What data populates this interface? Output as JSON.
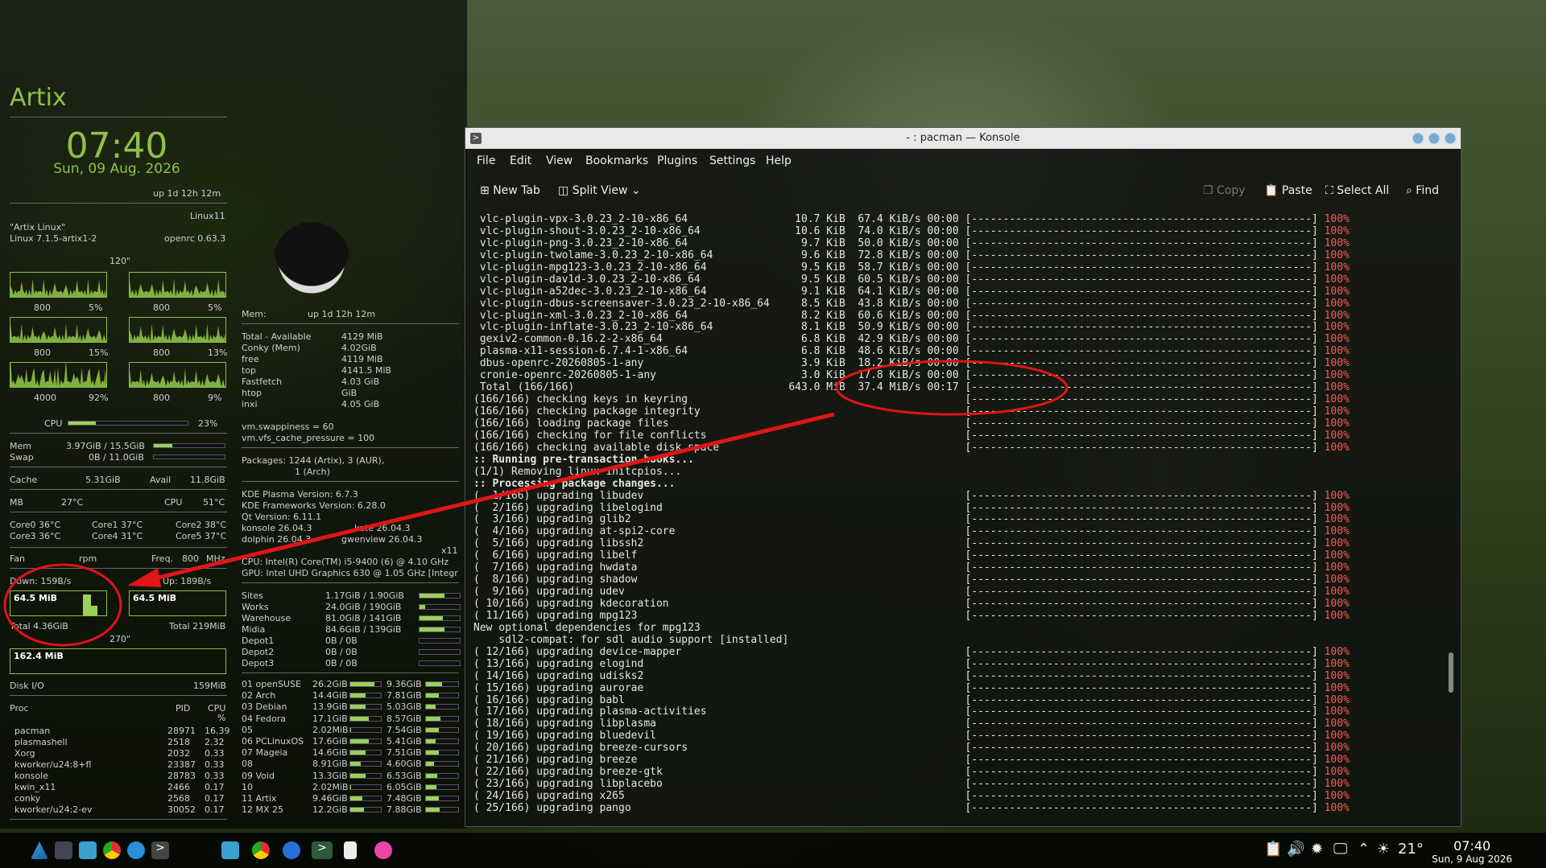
{
  "conky": {
    "distro": "Artix",
    "time": "07:40",
    "date": "Sun, 09 Aug. 2026",
    "uptime": "up 1d 12h 12m",
    "host": "Linux11",
    "os_name": "\"Artix Linux\"",
    "kernel": "Linux 7.1.5-artix1-2",
    "init": "openrc 0.63.3",
    "refresh": "120\"",
    "graphs": [
      {
        "freq": "800",
        "pct": "5%"
      },
      {
        "freq": "800",
        "pct": "5%"
      },
      {
        "freq": "800",
        "pct": "15%"
      },
      {
        "freq": "800",
        "pct": "13%"
      },
      {
        "freq": "4000",
        "pct": "92%"
      },
      {
        "freq": "800",
        "pct": "9%"
      }
    ],
    "cpu": {
      "label": "CPU",
      "pct": "23%",
      "fill": 0.23
    },
    "mem": {
      "label": "Mem",
      "value": "3.97GiB / 15.5GiB",
      "fill": 0.26
    },
    "swap": {
      "label": "Swap",
      "value": "0B / 11.0GiB",
      "fill": 0
    },
    "cache": {
      "label": "Cache",
      "value": "5.31GiB",
      "avail_label": "Avail",
      "avail": "11.8GiB"
    },
    "mb": {
      "label": "MB",
      "value": "27°C",
      "cpu_label": "CPU",
      "cpu_temp": "51°C"
    },
    "cores": [
      "Core0 36°C",
      "Core1 37°C",
      "Core2 38°C",
      "Core3 36°C",
      "Core4 31°C",
      "Core5 37°C"
    ],
    "fan": {
      "label": "Fan",
      "unit": "rpm",
      "freq_label": "Freq.",
      "freq": "800",
      "freq_unit": "MHz"
    },
    "net": {
      "down": "Down: 159B/s",
      "up": "Up: 189B/s",
      "down_box": "64.5 MiB",
      "up_box": "64.5 MiB",
      "total_down": "Total 4.36GiB",
      "total_up": "Total 219MiB",
      "interval": "270\""
    },
    "disk": {
      "box": "162.4 MiB",
      "label": "Disk I/O",
      "value": "159MiB"
    },
    "proc": {
      "label": "Proc",
      "pid_label": "PID",
      "cpu_label": "CPU",
      "pct_label": "%",
      "rows": [
        {
          "name": "pacman",
          "pid": "28971",
          "cpu": "16.39"
        },
        {
          "name": "plasmashell",
          "pid": "2518",
          "cpu": "2.32"
        },
        {
          "name": "Xorg",
          "pid": "2032",
          "cpu": "0.33"
        },
        {
          "name": "kworker/u24:8+fl",
          "pid": "23387",
          "cpu": "0.33"
        },
        {
          "name": "konsole",
          "pid": "28783",
          "cpu": "0.33"
        },
        {
          "name": "kwin_x11",
          "pid": "2466",
          "cpu": "0.17"
        },
        {
          "name": "conky",
          "pid": "2568",
          "cpu": "0.17"
        },
        {
          "name": "kworker/u24:2-ev",
          "pid": "30052",
          "cpu": "0.17"
        }
      ]
    },
    "memcol": {
      "mem_label": "Mem:",
      "uptime": "up 1d 12h 12m",
      "rows": [
        {
          "k": "Total - Available",
          "v": "4129 MiB"
        },
        {
          "k": "Conky (Mem)",
          "v": "4.02GiB"
        },
        {
          "k": "free",
          "v": "4119   MiB"
        },
        {
          "k": "top",
          "v": "4141.5  MiB"
        },
        {
          "k": "Fastfetch",
          "v": "4.03 GiB"
        },
        {
          "k": "htop",
          "v": "GiB"
        },
        {
          "k": "inxi",
          "v": "4.05 GiB"
        }
      ],
      "swappiness": "vm.swappiness = 60",
      "cache_pressure": "vm.vfs_cache_pressure = 100",
      "packages": "Packages: 1244 (Artix), 3 (AUR),",
      "packages2": "1 (Arch)",
      "plasma": "KDE Plasma Version: 6.7.3",
      "frameworks": "KDE Frameworks Version: 6.28.0",
      "qt": "Qt Version: 6.11.1",
      "konsole": "konsole 26.04.3",
      "kate": "kate 26.04.3",
      "dolphin": "dolphin 26.04.3",
      "gwenview": "gwenview 26.04.3",
      "x11": "x11",
      "cpuinfo": "CPU: Intel(R) Core(TM) i5-9400 (6) @ 4.10 GHz",
      "gpu": "GPU: Intel UHD Graphics 630 @ 1.05 GHz [Integr"
    },
    "mounts": [
      {
        "n": "Sites",
        "v": "1.17GiB  /  1.90GiB",
        "f": 0.62
      },
      {
        "n": "Works",
        "v": "24.0GiB  /  190GiB",
        "f": 0.13
      },
      {
        "n": "Warehouse",
        "v": "81.0GiB  /  141GiB",
        "f": 0.57
      },
      {
        "n": "Midia",
        "v": "84.6GiB  /  139GiB",
        "f": 0.61
      },
      {
        "n": "Depot1",
        "v": "0B  /  0B",
        "f": 0
      },
      {
        "n": "Depot2",
        "v": "0B  /  0B",
        "f": 0
      },
      {
        "n": "Depot3",
        "v": "0B  /  0B",
        "f": 0
      }
    ],
    "distros": [
      {
        "n": "01 openSUSE",
        "a": "26.2GiB",
        "b": "9.36GiB",
        "fa": 0.8,
        "fb": 0.5
      },
      {
        "n": "02 Arch",
        "a": "14.4GiB",
        "b": "7.81GiB",
        "fa": 0.5,
        "fb": 0.4
      },
      {
        "n": "03 Debian",
        "a": "13.9GiB",
        "b": "5.03GiB",
        "fa": 0.5,
        "fb": 0.3
      },
      {
        "n": "04 Fedora",
        "a": "17.1GiB",
        "b": "8.57GiB",
        "fa": 0.6,
        "fb": 0.45
      },
      {
        "n": "05",
        "a": "2.02MiB",
        "b": "7.54GiB",
        "fa": 0.02,
        "fb": 0.4
      },
      {
        "n": "06 PCLinuxOS",
        "a": "17.6GiB",
        "b": "5.41GiB",
        "fa": 0.6,
        "fb": 0.3
      },
      {
        "n": "07 Mageia",
        "a": "14.6GiB",
        "b": "7.51GiB",
        "fa": 0.5,
        "fb": 0.4
      },
      {
        "n": "08",
        "a": "8.91GiB",
        "b": "4.60GiB",
        "fa": 0.35,
        "fb": 0.25
      },
      {
        "n": "09 Void",
        "a": "13.3GiB",
        "b": "6.53GiB",
        "fa": 0.5,
        "fb": 0.35
      },
      {
        "n": "10",
        "a": "2.02MiB",
        "b": "6.05GiB",
        "fa": 0.02,
        "fb": 0.33
      },
      {
        "n": "11 Artix",
        "a": "9.46GiB",
        "b": "7.48GiB",
        "fa": 0.4,
        "fb": 0.4
      },
      {
        "n": "12 MX 25",
        "a": "12.2GiB",
        "b": "7.88GiB",
        "fa": 0.45,
        "fb": 0.42
      }
    ]
  },
  "konsole": {
    "title": "- : pacman — Konsole",
    "menu": [
      "File",
      "Edit",
      "View",
      "Bookmarks",
      "Plugins",
      "Settings",
      "Help"
    ],
    "toolbar": {
      "new_tab": "New Tab",
      "split_view": "Split View",
      "copy": "Copy",
      "paste": "Paste",
      "select_all": "Select All",
      "find": "Find"
    },
    "bar": "[------------------------------------------------------]",
    "lines": [
      {
        "t": " vlc-plugin-vpx-3.0.23_2-10-x86_64                 10.7 KiB  67.4 KiB/s 00:00 ",
        "b": 1,
        "p": "100%"
      },
      {
        "t": " vlc-plugin-shout-3.0.23_2-10-x86_64               10.6 KiB  74.0 KiB/s 00:00 ",
        "b": 1,
        "p": "100%"
      },
      {
        "t": " vlc-plugin-png-3.0.23_2-10-x86_64                  9.7 KiB  50.0 KiB/s 00:00 ",
        "b": 1,
        "p": "100%"
      },
      {
        "t": " vlc-plugin-twolame-3.0.23_2-10-x86_64              9.6 KiB  72.8 KiB/s 00:00 ",
        "b": 1,
        "p": "100%"
      },
      {
        "t": " vlc-plugin-mpg123-3.0.23_2-10-x86_64               9.5 KiB  58.7 KiB/s 00:00 ",
        "b": 1,
        "p": "100%"
      },
      {
        "t": " vlc-plugin-dav1d-3.0.23_2-10-x86_64                9.5 KiB  60.5 KiB/s 00:00 ",
        "b": 1,
        "p": "100%"
      },
      {
        "t": " vlc-plugin-a52dec-3.0.23_2-10-x86_64               9.1 KiB  64.1 KiB/s 00:00 ",
        "b": 1,
        "p": "100%"
      },
      {
        "t": " vlc-plugin-dbus-screensaver-3.0.23_2-10-x86_64     8.5 KiB  43.8 KiB/s 00:00 ",
        "b": 1,
        "p": "100%"
      },
      {
        "t": " vlc-plugin-xml-3.0.23_2-10-x86_64                  8.2 KiB  60.6 KiB/s 00:00 ",
        "b": 1,
        "p": "100%"
      },
      {
        "t": " vlc-plugin-inflate-3.0.23_2-10-x86_64              8.1 KiB  50.9 KiB/s 00:00 ",
        "b": 1,
        "p": "100%"
      },
      {
        "t": " gexiv2-common-0.16.2-2-x86_64                      6.8 KiB  42.9 KiB/s 00:00 ",
        "b": 1,
        "p": "100%"
      },
      {
        "t": " plasma-x11-session-6.7.4-1-x86_64                  6.8 KiB  48.6 KiB/s 00:00 ",
        "b": 1,
        "p": "100%"
      },
      {
        "t": " dbus-openrc-20260805-1-any                         3.9 KiB  18.2 KiB/s 00:00 ",
        "b": 1,
        "p": "100%"
      },
      {
        "t": " cronie-openrc-20260805-1-any                       3.0 KiB  17.8 KiB/s 00:00 ",
        "b": 1,
        "p": "100%"
      },
      {
        "t": " Total (166/166)                                  643.0 MiB  37.4 MiB/s 00:17 ",
        "b": 1,
        "p": "100%"
      },
      {
        "t": "(166/166) checking keys in keyring                                            ",
        "b": 1,
        "p": "100%"
      },
      {
        "t": "(166/166) checking package integrity                                          ",
        "b": 1,
        "p": "100%"
      },
      {
        "t": "(166/166) loading package files                                               ",
        "b": 1,
        "p": "100%"
      },
      {
        "t": "(166/166) checking for file conflicts                                         ",
        "b": 1,
        "p": "100%"
      },
      {
        "t": "(166/166) checking available disk space                                       ",
        "b": 1,
        "p": "100%"
      },
      {
        "t": ":: Running pre-transaction hooks...",
        "b": 0,
        "p": "",
        "bold": 1
      },
      {
        "t": "(1/1) Removing linux initcpios...",
        "b": 0,
        "p": ""
      },
      {
        "t": ":: Processing package changes...",
        "b": 0,
        "p": "",
        "bold": 1
      },
      {
        "t": "(  1/166) upgrading libudev                                                   ",
        "b": 1,
        "p": "100%"
      },
      {
        "t": "(  2/166) upgrading libelogind                                                ",
        "b": 1,
        "p": "100%"
      },
      {
        "t": "(  3/166) upgrading glib2                                                     ",
        "b": 1,
        "p": "100%"
      },
      {
        "t": "(  4/166) upgrading at-spi2-core                                              ",
        "b": 1,
        "p": "100%"
      },
      {
        "t": "(  5/166) upgrading libssh2                                                   ",
        "b": 1,
        "p": "100%"
      },
      {
        "t": "(  6/166) upgrading libelf                                                    ",
        "b": 1,
        "p": "100%"
      },
      {
        "t": "(  7/166) upgrading hwdata                                                    ",
        "b": 1,
        "p": "100%"
      },
      {
        "t": "(  8/166) upgrading shadow                                                    ",
        "b": 1,
        "p": "100%"
      },
      {
        "t": "(  9/166) upgrading udev                                                      ",
        "b": 1,
        "p": "100%"
      },
      {
        "t": "( 10/166) upgrading kdecoration                                               ",
        "b": 1,
        "p": "100%"
      },
      {
        "t": "( 11/166) upgrading mpg123                                                    ",
        "b": 1,
        "p": "100%"
      },
      {
        "t": "New optional dependencies for mpg123",
        "b": 0,
        "p": ""
      },
      {
        "t": "    sdl2-compat: for sdl audio support [installed]",
        "b": 0,
        "p": ""
      },
      {
        "t": "( 12/166) upgrading device-mapper                                             ",
        "b": 1,
        "p": "100%"
      },
      {
        "t": "( 13/166) upgrading elogind                                                   ",
        "b": 1,
        "p": "100%"
      },
      {
        "t": "( 14/166) upgrading udisks2                                                   ",
        "b": 1,
        "p": "100%"
      },
      {
        "t": "( 15/166) upgrading aurorae                                                   ",
        "b": 1,
        "p": "100%"
      },
      {
        "t": "( 16/166) upgrading babl                                                      ",
        "b": 1,
        "p": "100%"
      },
      {
        "t": "( 17/166) upgrading plasma-activities                                         ",
        "b": 1,
        "p": "100%"
      },
      {
        "t": "( 18/166) upgrading libplasma                                                 ",
        "b": 1,
        "p": "100%"
      },
      {
        "t": "( 19/166) upgrading bluedevil                                                 ",
        "b": 1,
        "p": "100%"
      },
      {
        "t": "( 20/166) upgrading breeze-cursors                                            ",
        "b": 1,
        "p": "100%"
      },
      {
        "t": "( 21/166) upgrading breeze                                                    ",
        "b": 1,
        "p": "100%"
      },
      {
        "t": "( 22/166) upgrading breeze-gtk                                                ",
        "b": 1,
        "p": "100%"
      },
      {
        "t": "( 23/166) upgrading libplacebo                                                ",
        "b": 1,
        "p": "100%"
      },
      {
        "t": "( 24/166) upgrading x265                                                      ",
        "b": 1,
        "p": "100%"
      },
      {
        "t": "( 25/166) upgrading pango                                                     ",
        "b": 1,
        "p": "100%"
      }
    ]
  },
  "taskbar": {
    "time": "07:40",
    "date": "Sun, 9 Aug 2026",
    "temp": "21°"
  },
  "colors": {
    "accent": "#8fc04a",
    "annotation": "#e01515",
    "percent": "#ff5959"
  }
}
